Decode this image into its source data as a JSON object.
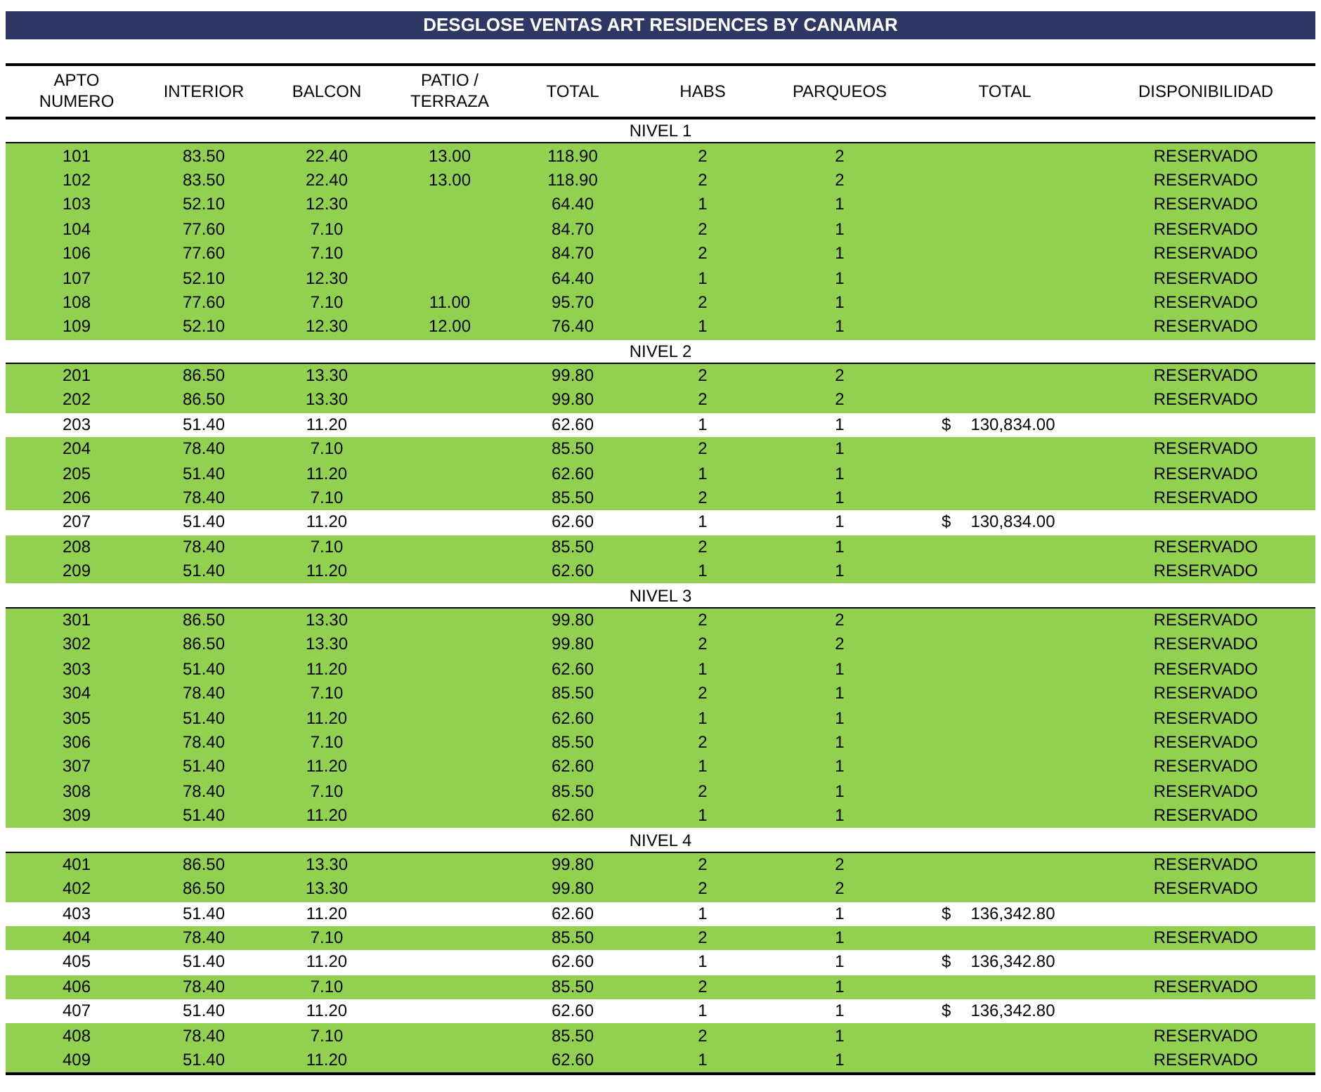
{
  "title": "DESGLOSE VENTAS ART RESIDENCES BY CANAMAR",
  "columns": [
    [
      "APTO",
      "NUMERO"
    ],
    [
      "INTERIOR"
    ],
    [
      "BALCON"
    ],
    [
      "PATIO /",
      "TERRAZA"
    ],
    [
      "TOTAL"
    ],
    [
      "HABS"
    ],
    [
      "PARQUEOS"
    ],
    [
      "TOTAL"
    ],
    [
      "DISPONIBILIDAD"
    ]
  ],
  "levels": [
    {
      "title": "NIVEL 1",
      "rows": [
        {
          "apto": "101",
          "interior": "83.50",
          "balcon": "22.40",
          "patio": "13.00",
          "total": "118.90",
          "habs": "2",
          "parqueos": "2",
          "status": "RESERVADO",
          "highlighted": true
        },
        {
          "apto": "102",
          "interior": "83.50",
          "balcon": "22.40",
          "patio": "13.00",
          "total": "118.90",
          "habs": "2",
          "parqueos": "2",
          "status": "RESERVADO",
          "highlighted": true
        },
        {
          "apto": "103",
          "interior": "52.10",
          "balcon": "12.30",
          "total": "64.40",
          "habs": "1",
          "parqueos": "1",
          "status": "RESERVADO",
          "highlighted": true
        },
        {
          "apto": "104",
          "interior": "77.60",
          "balcon": "7.10",
          "total": "84.70",
          "habs": "2",
          "parqueos": "1",
          "status": "RESERVADO",
          "highlighted": true
        },
        {
          "apto": "106",
          "interior": "77.60",
          "balcon": "7.10",
          "total": "84.70",
          "habs": "2",
          "parqueos": "1",
          "status": "RESERVADO",
          "highlighted": true
        },
        {
          "apto": "107",
          "interior": "52.10",
          "balcon": "12.30",
          "total": "64.40",
          "habs": "1",
          "parqueos": "1",
          "status": "RESERVADO",
          "highlighted": true
        },
        {
          "apto": "108",
          "interior": "77.60",
          "balcon": "7.10",
          "patio": "11.00",
          "total": "95.70",
          "habs": "2",
          "parqueos": "1",
          "status": "RESERVADO",
          "highlighted": true
        },
        {
          "apto": "109",
          "interior": "52.10",
          "balcon": "12.30",
          "patio": "12.00",
          "total": "76.40",
          "habs": "1",
          "parqueos": "1",
          "status": "RESERVADO",
          "highlighted": true
        }
      ]
    },
    {
      "title": "NIVEL 2",
      "rows": [
        {
          "apto": "201",
          "interior": "86.50",
          "balcon": "13.30",
          "total": "99.80",
          "habs": "2",
          "parqueos": "2",
          "status": "RESERVADO",
          "highlighted": true
        },
        {
          "apto": "202",
          "interior": "86.50",
          "balcon": "13.30",
          "total": "99.80",
          "habs": "2",
          "parqueos": "2",
          "status": "RESERVADO",
          "highlighted": true
        },
        {
          "apto": "203",
          "interior": "51.40",
          "balcon": "11.20",
          "total": "62.60",
          "habs": "1",
          "parqueos": "1",
          "price": {
            "currency": "$",
            "amount": "130,834.00"
          },
          "highlighted": false
        },
        {
          "apto": "204",
          "interior": "78.40",
          "balcon": "7.10",
          "total": "85.50",
          "habs": "2",
          "parqueos": "1",
          "status": "RESERVADO",
          "highlighted": true
        },
        {
          "apto": "205",
          "interior": "51.40",
          "balcon": "11.20",
          "total": "62.60",
          "habs": "1",
          "parqueos": "1",
          "status": "RESERVADO",
          "highlighted": true
        },
        {
          "apto": "206",
          "interior": "78.40",
          "balcon": "7.10",
          "total": "85.50",
          "habs": "2",
          "parqueos": "1",
          "status": "RESERVADO",
          "highlighted": true
        },
        {
          "apto": "207",
          "interior": "51.40",
          "balcon": "11.20",
          "total": "62.60",
          "habs": "1",
          "parqueos": "1",
          "price": {
            "currency": "$",
            "amount": "130,834.00"
          },
          "highlighted": false
        },
        {
          "apto": "208",
          "interior": "78.40",
          "balcon": "7.10",
          "total": "85.50",
          "habs": "2",
          "parqueos": "1",
          "status": "RESERVADO",
          "highlighted": true
        },
        {
          "apto": "209",
          "interior": "51.40",
          "balcon": "11.20",
          "total": "62.60",
          "habs": "1",
          "parqueos": "1",
          "status": "RESERVADO",
          "highlighted": true
        }
      ]
    },
    {
      "title": "NIVEL 3",
      "rows": [
        {
          "apto": "301",
          "interior": "86.50",
          "balcon": "13.30",
          "total": "99.80",
          "habs": "2",
          "parqueos": "2",
          "status": "RESERVADO",
          "highlighted": true
        },
        {
          "apto": "302",
          "interior": "86.50",
          "balcon": "13.30",
          "total": "99.80",
          "habs": "2",
          "parqueos": "2",
          "status": "RESERVADO",
          "highlighted": true
        },
        {
          "apto": "303",
          "interior": "51.40",
          "balcon": "11.20",
          "total": "62.60",
          "habs": "1",
          "parqueos": "1",
          "status": "RESERVADO",
          "highlighted": true
        },
        {
          "apto": "304",
          "interior": "78.40",
          "balcon": "7.10",
          "total": "85.50",
          "habs": "2",
          "parqueos": "1",
          "status": "RESERVADO",
          "highlighted": true
        },
        {
          "apto": "305",
          "interior": "51.40",
          "balcon": "11.20",
          "total": "62.60",
          "habs": "1",
          "parqueos": "1",
          "status": "RESERVADO",
          "highlighted": true
        },
        {
          "apto": "306",
          "interior": "78.40",
          "balcon": "7.10",
          "total": "85.50",
          "habs": "2",
          "parqueos": "1",
          "status": "RESERVADO",
          "highlighted": true
        },
        {
          "apto": "307",
          "interior": "51.40",
          "balcon": "11.20",
          "total": "62.60",
          "habs": "1",
          "parqueos": "1",
          "status": "RESERVADO",
          "highlighted": true
        },
        {
          "apto": "308",
          "interior": "78.40",
          "balcon": "7.10",
          "total": "85.50",
          "habs": "2",
          "parqueos": "1",
          "status": "RESERVADO",
          "highlighted": true
        },
        {
          "apto": "309",
          "interior": "51.40",
          "balcon": "11.20",
          "total": "62.60",
          "habs": "1",
          "parqueos": "1",
          "status": "RESERVADO",
          "highlighted": true
        }
      ]
    },
    {
      "title": "NIVEL 4",
      "rows": [
        {
          "apto": "401",
          "interior": "86.50",
          "balcon": "13.30",
          "total": "99.80",
          "habs": "2",
          "parqueos": "2",
          "status": "RESERVADO",
          "highlighted": true
        },
        {
          "apto": "402",
          "interior": "86.50",
          "balcon": "13.30",
          "total": "99.80",
          "habs": "2",
          "parqueos": "2",
          "status": "RESERVADO",
          "highlighted": true
        },
        {
          "apto": "403",
          "interior": "51.40",
          "balcon": "11.20",
          "total": "62.60",
          "habs": "1",
          "parqueos": "1",
          "price": {
            "currency": "$",
            "amount": "136,342.80"
          },
          "highlighted": false
        },
        {
          "apto": "404",
          "interior": "78.40",
          "balcon": "7.10",
          "total": "85.50",
          "habs": "2",
          "parqueos": "1",
          "status": "RESERVADO",
          "highlighted": true
        },
        {
          "apto": "405",
          "interior": "51.40",
          "balcon": "11.20",
          "total": "62.60",
          "habs": "1",
          "parqueos": "1",
          "price": {
            "currency": "$",
            "amount": "136,342.80"
          },
          "highlighted": false
        },
        {
          "apto": "406",
          "interior": "78.40",
          "balcon": "7.10",
          "total": "85.50",
          "habs": "2",
          "parqueos": "1",
          "status": "RESERVADO",
          "highlighted": true
        },
        {
          "apto": "407",
          "interior": "51.40",
          "balcon": "11.20",
          "total": "62.60",
          "habs": "1",
          "parqueos": "1",
          "price": {
            "currency": "$",
            "amount": "136,342.80"
          },
          "highlighted": false
        },
        {
          "apto": "408",
          "interior": "78.40",
          "balcon": "7.10",
          "total": "85.50",
          "habs": "2",
          "parqueos": "1",
          "status": "RESERVADO",
          "highlighted": true
        },
        {
          "apto": "409",
          "interior": "51.40",
          "balcon": "11.20",
          "total": "62.60",
          "habs": "1",
          "parqueos": "1",
          "status": "RESERVADO",
          "highlighted": true
        }
      ]
    }
  ]
}
